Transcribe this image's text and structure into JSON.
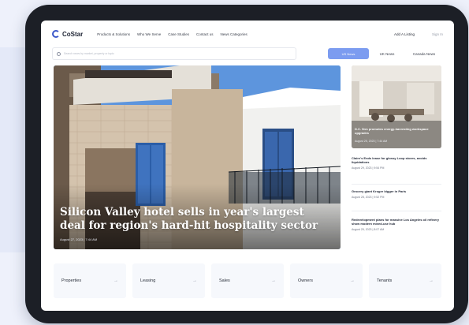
{
  "brand": {
    "name": "CoStar"
  },
  "nav": {
    "links": [
      "Products & Solutions",
      "Who We Serve",
      "Case Studies",
      "Contact us",
      "News Categories"
    ],
    "ad": "Add A Listing",
    "signin": "Sign In"
  },
  "search": {
    "placeholder": "Search news by market, property or topic",
    "regions": [
      "US News",
      "UK News",
      "Canada News"
    ]
  },
  "hero": {
    "title": "Silicon Valley hotel sells in year's largest deal for region's hard-hit hospitality sector",
    "date": "August 27, 2023 | 7:44 AM"
  },
  "sidebar": {
    "feature": {
      "caption": "D.C. firm promotes energy-harvesting workspace upgrades",
      "date": "August 25, 2023 | 7:44 AM"
    },
    "items": [
      {
        "title": "Claire's Ends lease for glossy Loop stores, avoids liquidations",
        "date": "August 29, 2023 | 9:54 PM"
      },
      {
        "title": "Grocery giant Kroger bigger in Paris",
        "date": "August 28, 2023 | 9:52 PM"
      },
      {
        "title": "Redevelopment plans for massive Los Angeles oil refinery show modern mixed-use hub",
        "date": "August 25, 2023 | 8:07 AM"
      }
    ]
  },
  "categories": [
    {
      "label": "Properties",
      "arrow": "→"
    },
    {
      "label": "Leasing",
      "arrow": "→"
    },
    {
      "label": "Sales",
      "arrow": "→"
    },
    {
      "label": "Owners",
      "arrow": "→"
    },
    {
      "label": "Tenants",
      "arrow": "→"
    }
  ],
  "colors": {
    "accent": "#7c9cf0",
    "device": "#1c1f26",
    "background": "#eef1fb"
  }
}
